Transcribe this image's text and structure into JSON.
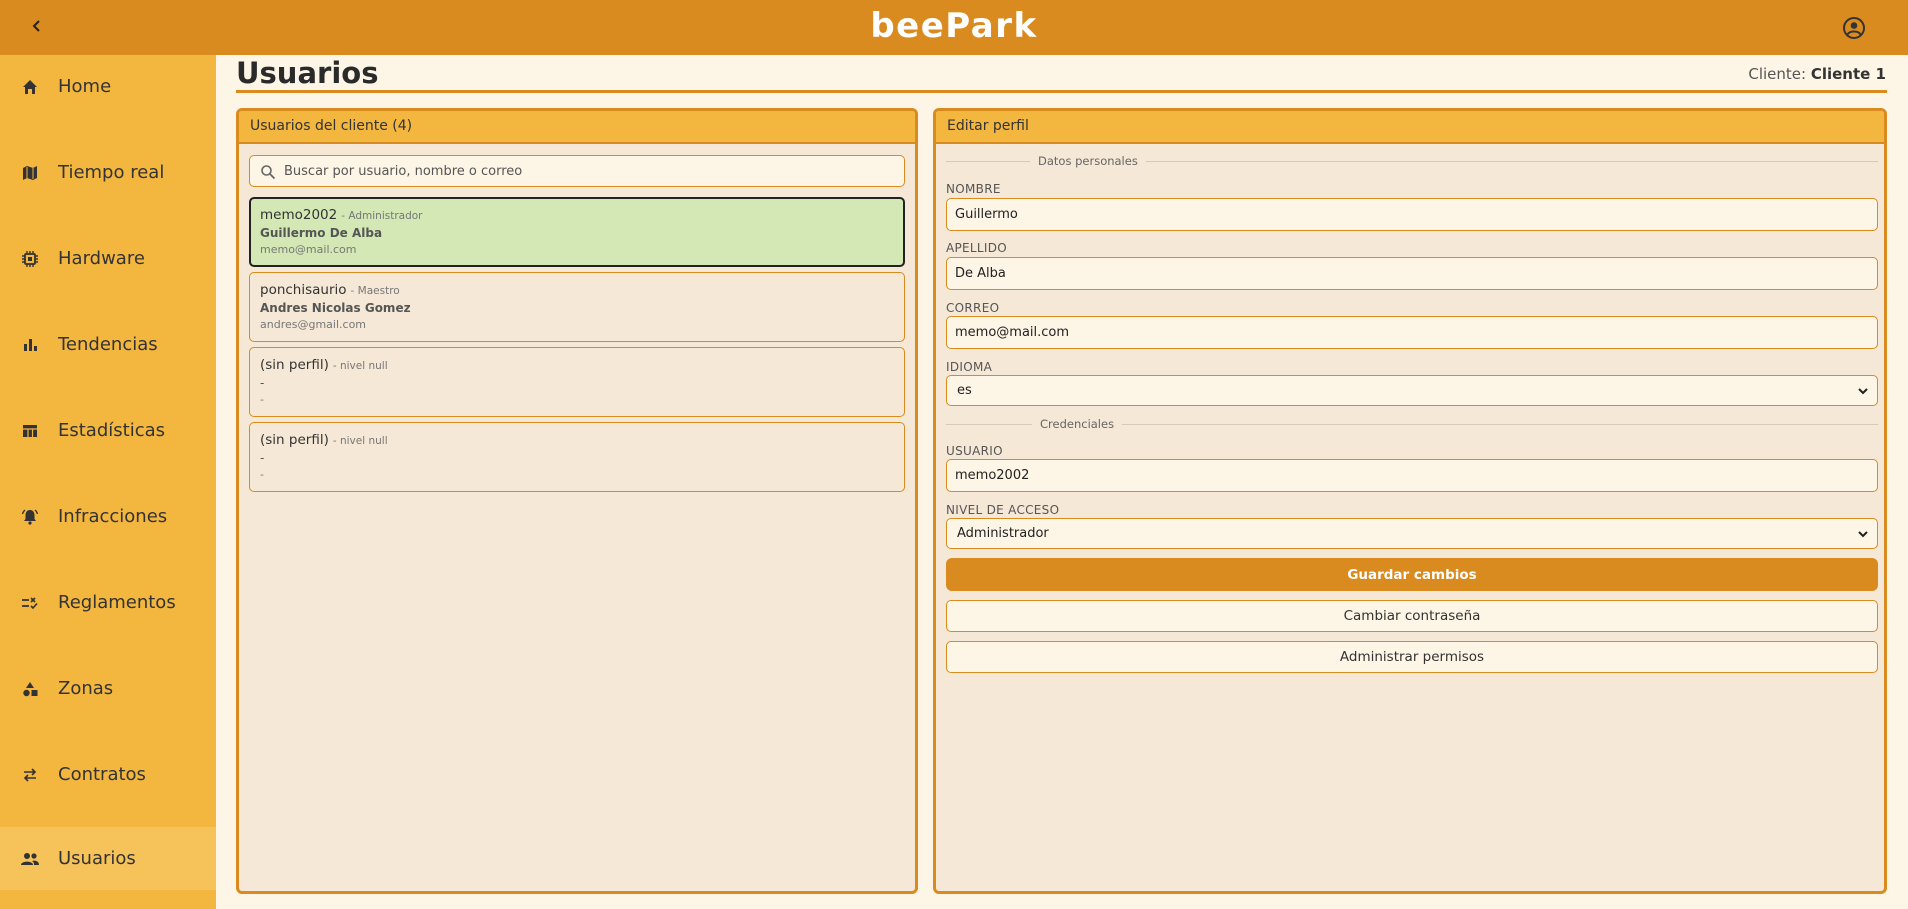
{
  "app": {
    "brand": "beePark"
  },
  "topbar": {
    "back_icon": "chevron-left-icon",
    "account_icon": "account-circle-icon"
  },
  "sidebar": {
    "items": [
      {
        "label": "Home",
        "icon": "home-icon"
      },
      {
        "label": "Tiempo real",
        "icon": "map-icon"
      },
      {
        "label": "Hardware",
        "icon": "chip-icon"
      },
      {
        "label": "Tendencias",
        "icon": "bar-chart-icon"
      },
      {
        "label": "Estadísticas",
        "icon": "table-icon"
      },
      {
        "label": "Infracciones",
        "icon": "bell-alert-icon"
      },
      {
        "label": "Reglamentos",
        "icon": "rule-icon"
      },
      {
        "label": "Zonas",
        "icon": "shapes-icon"
      },
      {
        "label": "Contratos",
        "icon": "swap-icon"
      },
      {
        "label": "Usuarios",
        "icon": "people-icon",
        "active": true
      }
    ]
  },
  "page": {
    "title": "Usuarios",
    "client_label": "Cliente:",
    "client_name": "Cliente 1"
  },
  "users_panel": {
    "title": "Usuarios del cliente (4)",
    "search_placeholder": "Buscar por usuario, nombre o correo",
    "users": [
      {
        "username": "memo2002",
        "role": "- Administrador",
        "name": "Guillermo De Alba",
        "email": "memo@mail.com",
        "selected": true
      },
      {
        "username": "ponchisaurio",
        "role": "- Maestro",
        "name": "Andres Nicolas Gomez",
        "email": "andres@gmail.com",
        "selected": false
      },
      {
        "username": "(sin perfil)",
        "role": "- nivel null",
        "name": "-",
        "email": "-",
        "selected": false
      },
      {
        "username": "(sin perfil)",
        "role": "- nivel null",
        "name": "-",
        "email": "-",
        "selected": false
      }
    ]
  },
  "edit_panel": {
    "title": "Editar perfil",
    "section_personal": "Datos personales",
    "nombre_label": "NOMBRE",
    "nombre_value": "Guillermo",
    "apellido_label": "APELLIDO",
    "apellido_value": "De Alba",
    "correo_label": "CORREO",
    "correo_value": "memo@mail.com",
    "idioma_label": "IDIOMA",
    "idioma_value": "es",
    "section_credentials": "Credenciales",
    "usuario_label": "USUARIO",
    "usuario_value": "memo2002",
    "nivel_label": "NIVEL DE ACCESO",
    "nivel_value": "Administrador",
    "save_label": "Guardar cambios",
    "change_password_label": "Cambiar contraseña",
    "permissions_label": "Administrar permisos"
  },
  "colors": {
    "primary": "#d98b1f",
    "sidebar": "#f3b63f",
    "selected_card": "#d3e8b5",
    "panel_bg": "#f5e8d6",
    "page_bg": "#fdf5e6"
  }
}
